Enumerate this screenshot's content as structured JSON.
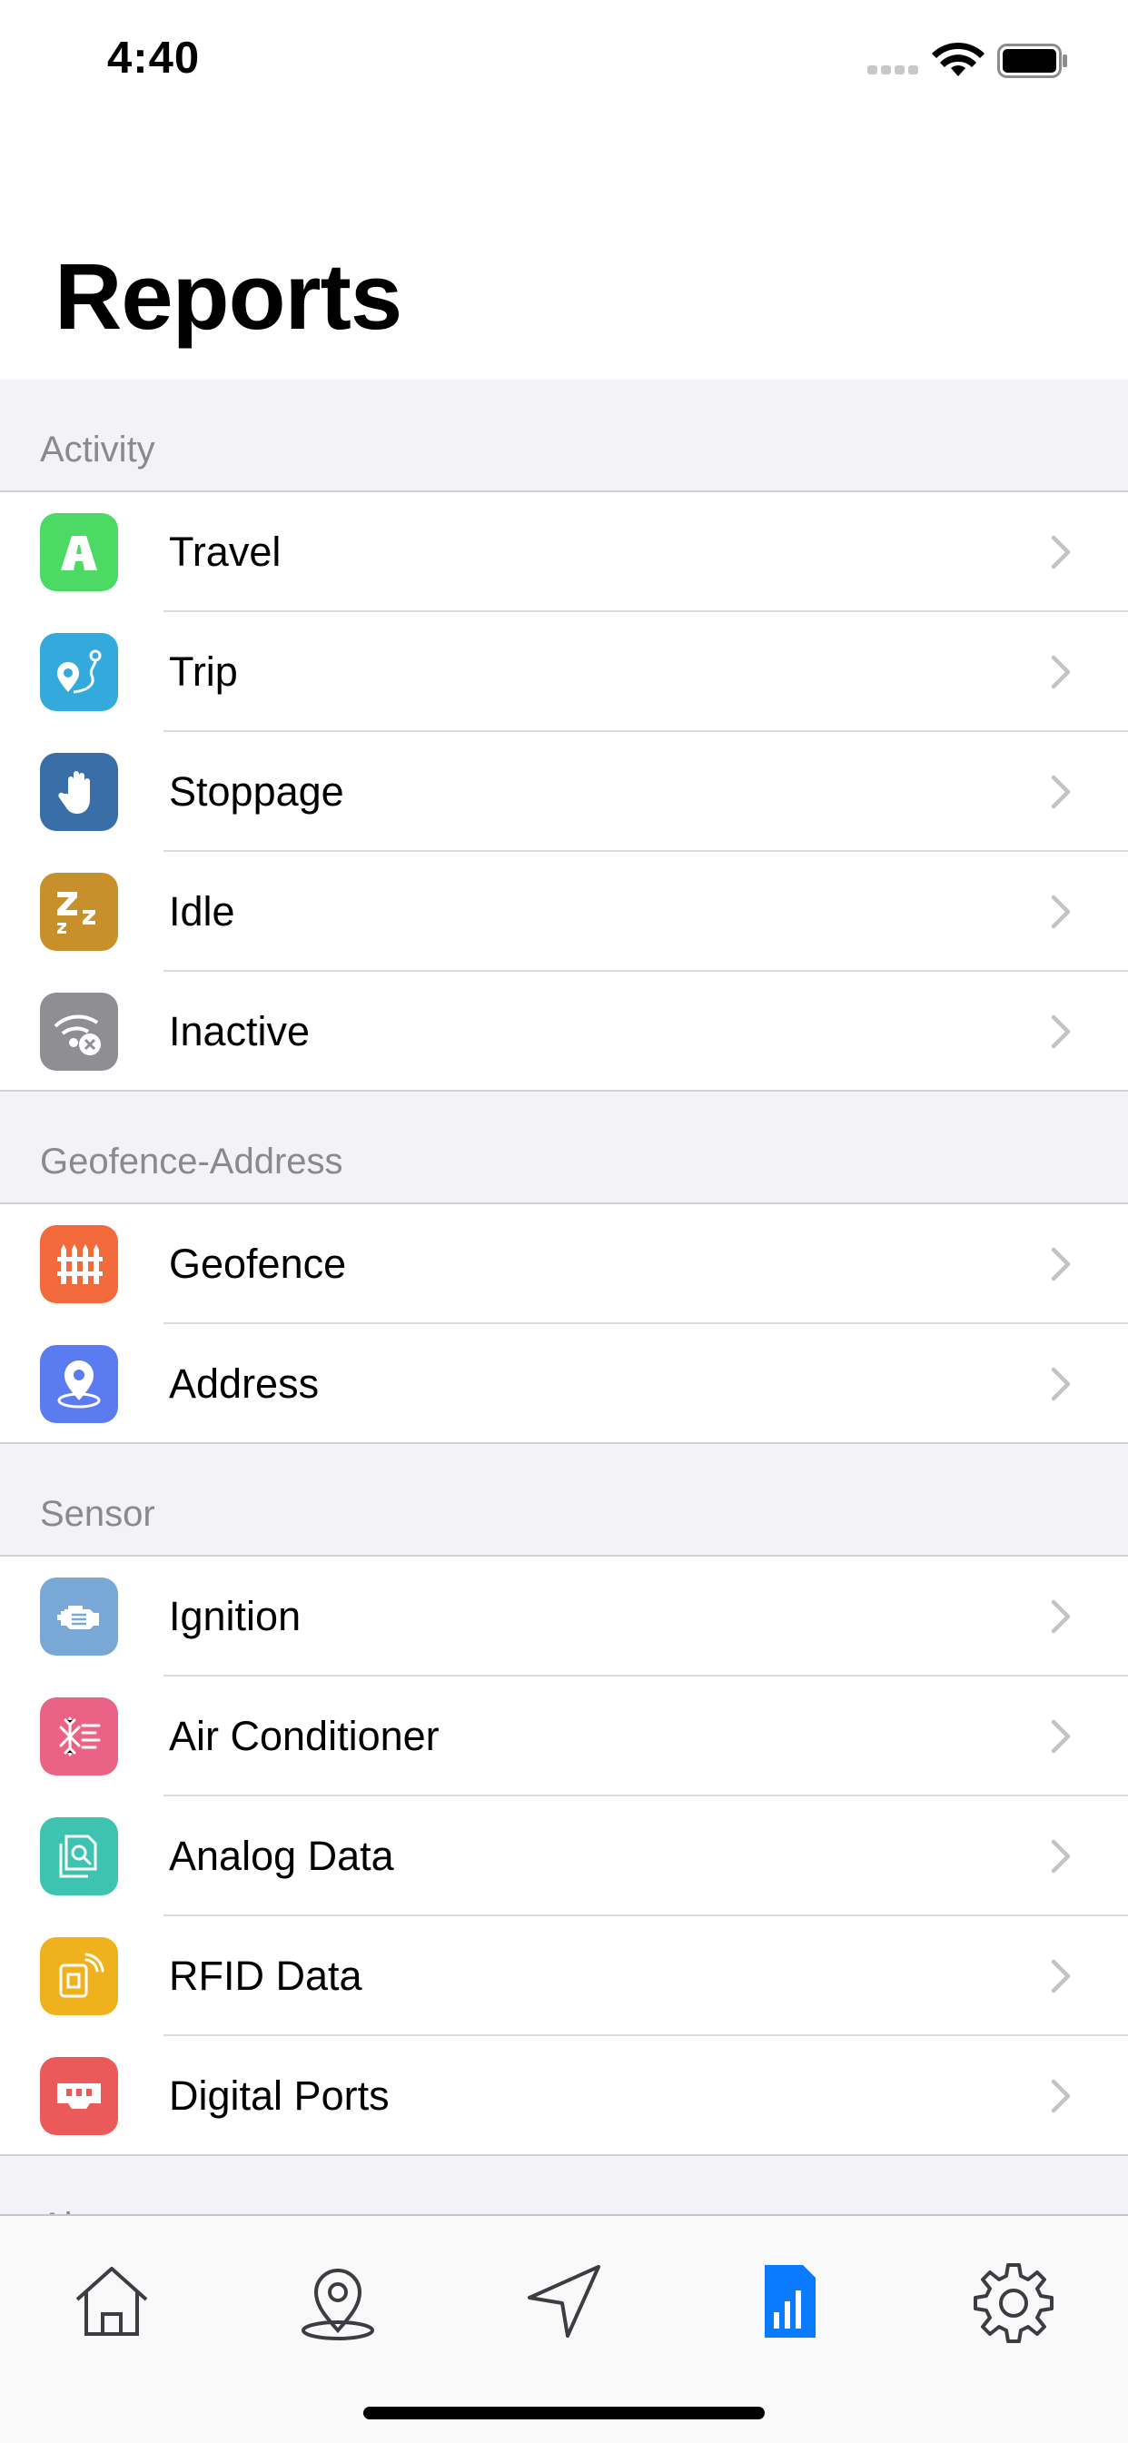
{
  "status": {
    "time": "4:40"
  },
  "header": {
    "title": "Reports"
  },
  "sections": [
    {
      "label": "Activity",
      "items": [
        {
          "label": "Travel",
          "icon": "road-icon",
          "color": "#4cd964"
        },
        {
          "label": "Trip",
          "icon": "route-pin-icon",
          "color": "#34aadc"
        },
        {
          "label": "Stoppage",
          "icon": "hand-stop-icon",
          "color": "#3a6ea8"
        },
        {
          "label": "Idle",
          "icon": "sleep-zzz-icon",
          "color": "#c8902b"
        },
        {
          "label": "Inactive",
          "icon": "signal-off-icon",
          "color": "#8e8e93"
        }
      ]
    },
    {
      "label": "Geofence-Address",
      "items": [
        {
          "label": "Geofence",
          "icon": "fence-icon",
          "color": "#f26a3c"
        },
        {
          "label": "Address",
          "icon": "location-pin-icon",
          "color": "#5b7cf0"
        }
      ]
    },
    {
      "label": "Sensor",
      "items": [
        {
          "label": "Ignition",
          "icon": "engine-icon",
          "color": "#7aa8d6"
        },
        {
          "label": "Air Conditioner",
          "icon": "snowflake-icon",
          "color": "#ea6384"
        },
        {
          "label": "Analog Data",
          "icon": "analog-document-icon",
          "color": "#3ec3b0"
        },
        {
          "label": "RFID Data",
          "icon": "rfid-card-icon",
          "color": "#f0b21c"
        },
        {
          "label": "Digital Ports",
          "icon": "port-connector-icon",
          "color": "#ea5a5a"
        }
      ]
    },
    {
      "label": "Alert",
      "items": []
    }
  ],
  "tabs": [
    {
      "name": "home",
      "icon": "home-icon",
      "active": false
    },
    {
      "name": "map",
      "icon": "map-pin-icon",
      "active": false
    },
    {
      "name": "navigate",
      "icon": "navigation-arrow-icon",
      "active": false
    },
    {
      "name": "reports",
      "icon": "reports-icon",
      "active": true
    },
    {
      "name": "settings",
      "icon": "gear-icon",
      "active": false
    }
  ],
  "colors": {
    "accent": "#0a7aff",
    "tab_inactive": "#3c3c43"
  }
}
